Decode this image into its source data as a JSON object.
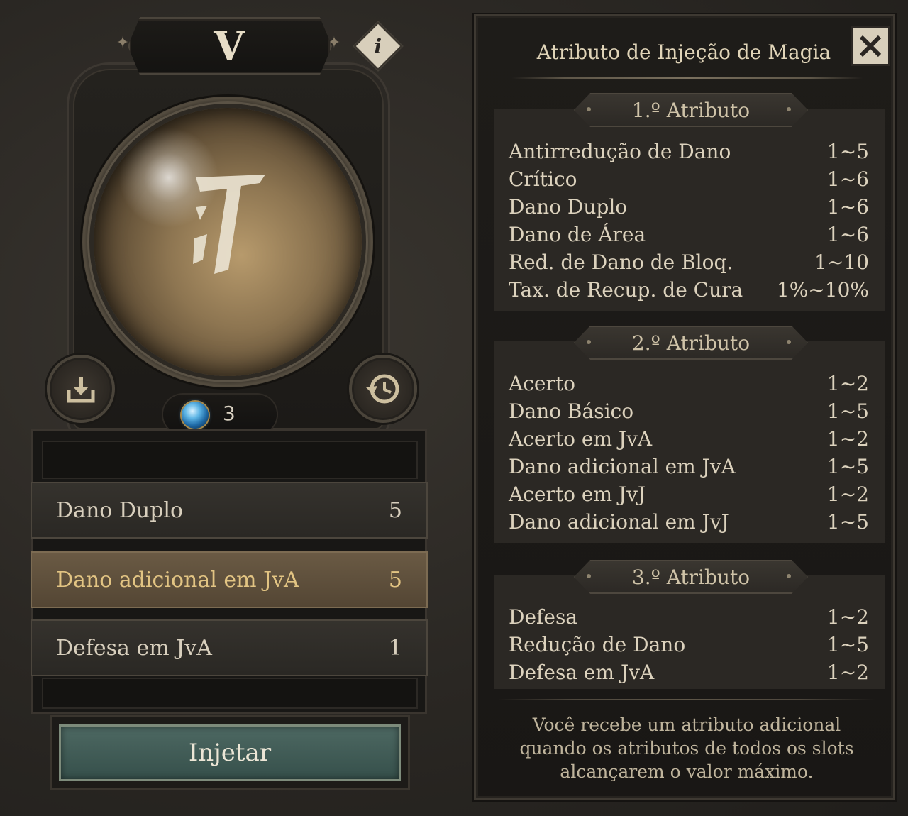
{
  "left": {
    "tier_label": "V",
    "info_icon": "i",
    "gem_count": "3",
    "slots": [
      {
        "label": "Dano Duplo",
        "value": "5",
        "active": false
      },
      {
        "label": "Dano adicional em JvA",
        "value": "5",
        "active": true
      },
      {
        "label": "Defesa em JvA",
        "value": "1",
        "active": false
      }
    ],
    "inject_label": "Injetar",
    "icons": [
      "info-icon",
      "download-icon",
      "history-icon",
      "gem-icon",
      "rune-glyph"
    ]
  },
  "right": {
    "title": "Atributo de Injeção de Magia",
    "close_icon": "close-icon",
    "sections": [
      {
        "header": "1.º Atributo",
        "rows": [
          {
            "name": "Antirredução de Dano",
            "range": "1~5"
          },
          {
            "name": "Crítico",
            "range": "1~6"
          },
          {
            "name": "Dano Duplo",
            "range": "1~6"
          },
          {
            "name": "Dano de Área",
            "range": "1~6"
          },
          {
            "name": "Red. de Dano de Bloq.",
            "range": "1~10"
          },
          {
            "name": "Tax. de Recup. de Cura",
            "range": "1%~10%"
          }
        ]
      },
      {
        "header": "2.º Atributo",
        "rows": [
          {
            "name": "Acerto",
            "range": "1~2"
          },
          {
            "name": "Dano Básico",
            "range": "1~5"
          },
          {
            "name": "Acerto em JvA",
            "range": "1~2"
          },
          {
            "name": "Dano adicional em JvA",
            "range": "1~5"
          },
          {
            "name": "Acerto em JvJ",
            "range": "1~2"
          },
          {
            "name": "Dano adicional em JvJ",
            "range": "1~5"
          }
        ]
      },
      {
        "header": "3.º Atributo",
        "rows": [
          {
            "name": "Defesa",
            "range": "1~2"
          },
          {
            "name": "Redução de Dano",
            "range": "1~5"
          },
          {
            "name": "Defesa em JvA",
            "range": "1~2"
          }
        ]
      }
    ],
    "footer_lines": [
      "Você recebe um atributo adicional",
      "quando os atributos de todos os slots",
      "alcançarem o valor máximo."
    ]
  },
  "colors": {
    "active_slot_text": "#e2c483",
    "inject_button": "#4d6862",
    "gem_blue": "#5fb6e6"
  }
}
